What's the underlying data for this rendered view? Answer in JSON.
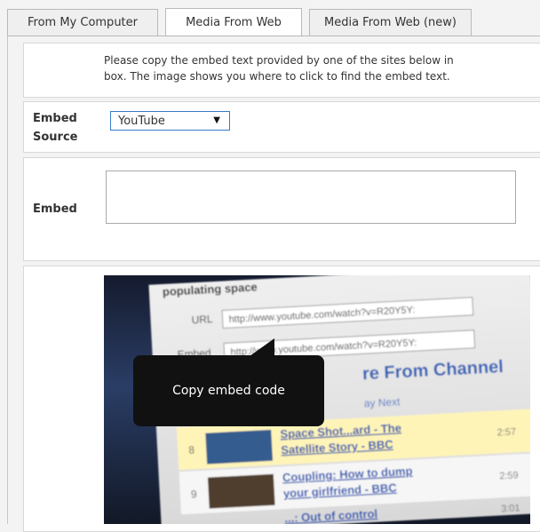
{
  "tabs": [
    {
      "label": "From My Computer"
    },
    {
      "label": "Media From Web"
    },
    {
      "label": "Media From Web (new)"
    }
  ],
  "instructions": {
    "line1": "Please copy the embed text provided by one of the sites below in",
    "line2": "box. The image shows you where to click to find the embed text."
  },
  "embed_source": {
    "label_line1": "Embed",
    "label_line2": "Source",
    "selected": "YouTube"
  },
  "embed": {
    "label": "Embed"
  },
  "example": {
    "heading_text": "populating space",
    "url_label": "URL",
    "url_value": "http://www.youtube.com/watch?v=R20Y5Y:",
    "embed_label": "Embed",
    "embed_value": "http://www.youtube.com/watch?v=R20Y5Y:",
    "channel_title": "re From Channel",
    "play_next": "ay Next",
    "videos": [
      {
        "num": "8",
        "title_line1": "Space Shot...ard - The",
        "title_line2": "Satellite Story - BBC",
        "time": "2:57"
      },
      {
        "num": "9",
        "title_line1": "Coupling: How to dump",
        "title_line2": "your girlfriend - BBC",
        "time": "2:59"
      },
      {
        "num": "",
        "title_line1": "...: Out of control",
        "title_line2": "",
        "time": "3:01"
      }
    ],
    "tooltip": "Copy embed code"
  },
  "colors": {
    "accent": "#3a79c8",
    "link": "#1a4fb0",
    "tooltip_bg": "#111111"
  }
}
